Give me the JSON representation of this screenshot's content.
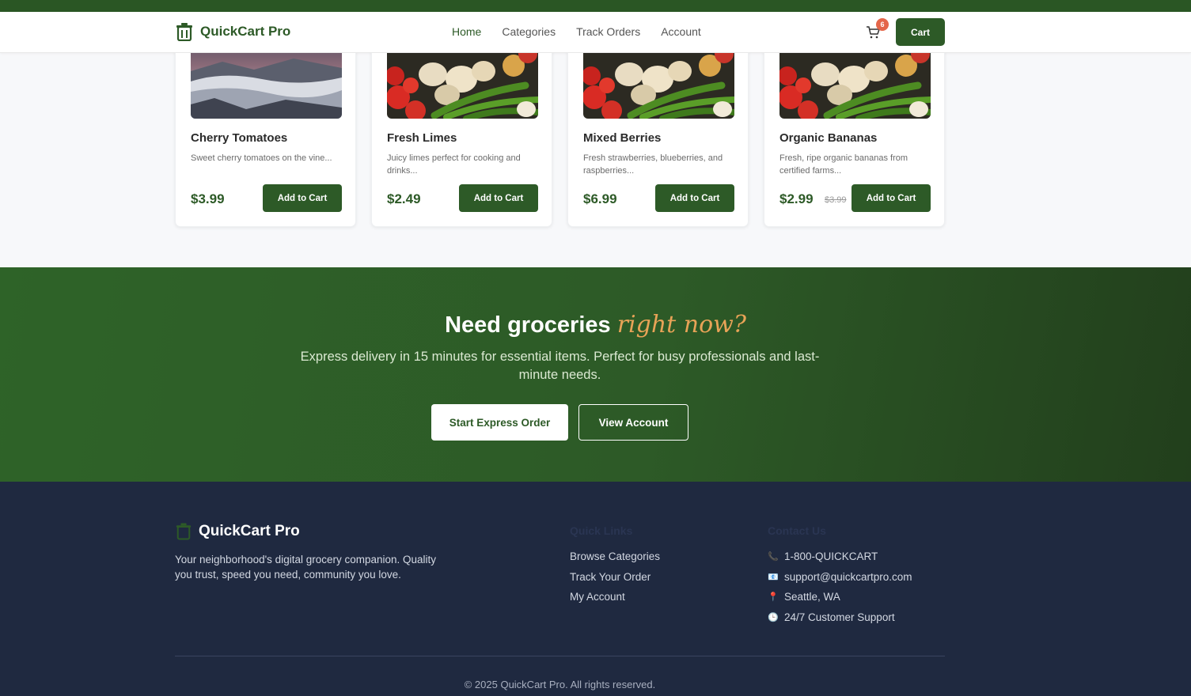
{
  "header": {
    "brand": "QuickCart Pro",
    "nav": [
      {
        "label": "Home",
        "active": true
      },
      {
        "label": "Categories",
        "active": false
      },
      {
        "label": "Track Orders",
        "active": false
      },
      {
        "label": "Account",
        "active": false
      }
    ],
    "cart_count": "6",
    "cart_label": "Cart"
  },
  "products": [
    {
      "name": "Cherry Tomatoes",
      "description": "Sweet cherry tomatoes on the vine...",
      "price": "$3.99",
      "old_price": "",
      "button": "Add to Cart",
      "image": "mountain-fog-photo"
    },
    {
      "name": "Fresh Limes",
      "description": "Juicy limes perfect for cooking and drinks...",
      "price": "$2.49",
      "old_price": "",
      "button": "Add to Cart",
      "image": "vegetables-photo"
    },
    {
      "name": "Mixed Berries",
      "description": "Fresh strawberries, blueberries, and raspberries...",
      "price": "$6.99",
      "old_price": "",
      "button": "Add to Cart",
      "image": "vegetables-photo"
    },
    {
      "name": "Organic Bananas",
      "description": "Fresh, ripe organic bananas from certified farms...",
      "price": "$2.99",
      "old_price": "$3.99",
      "button": "Add to Cart",
      "image": "vegetables-photo"
    }
  ],
  "express": {
    "title_main": "Need groceries",
    "title_accent": "right now?",
    "subtitle": "Express delivery in 15 minutes for essential items. Perfect for busy professionals and last-minute needs.",
    "primary_button": "Start Express Order",
    "secondary_button": "View Account"
  },
  "footer": {
    "brand": "QuickCart Pro",
    "tagline": "Your neighborhood's digital grocery companion. Quality you trust, speed you need, community you love.",
    "quick_links_title": "Quick Links",
    "quick_links": [
      "Browse Categories",
      "Track Your Order",
      "My Account"
    ],
    "contact_title": "Contact Us",
    "contact": [
      {
        "icon": "phone-icon",
        "glyph": "📞",
        "text": "1-800-QUICKCART"
      },
      {
        "icon": "email-icon",
        "glyph": "📧",
        "text": "support@quickcartpro.com"
      },
      {
        "icon": "location-pin-icon",
        "glyph": "📍",
        "text": "Seattle, WA"
      },
      {
        "icon": "clock-icon",
        "glyph": "🕒",
        "text": "24/7 Customer Support"
      }
    ],
    "copyright": "© 2025 QuickCart Pro. All rights reserved."
  },
  "colors": {
    "brand_green": "#2d5a27",
    "accent_orange": "#e8a357",
    "badge_red": "#e4664a",
    "footer_navy": "#1f2940"
  }
}
